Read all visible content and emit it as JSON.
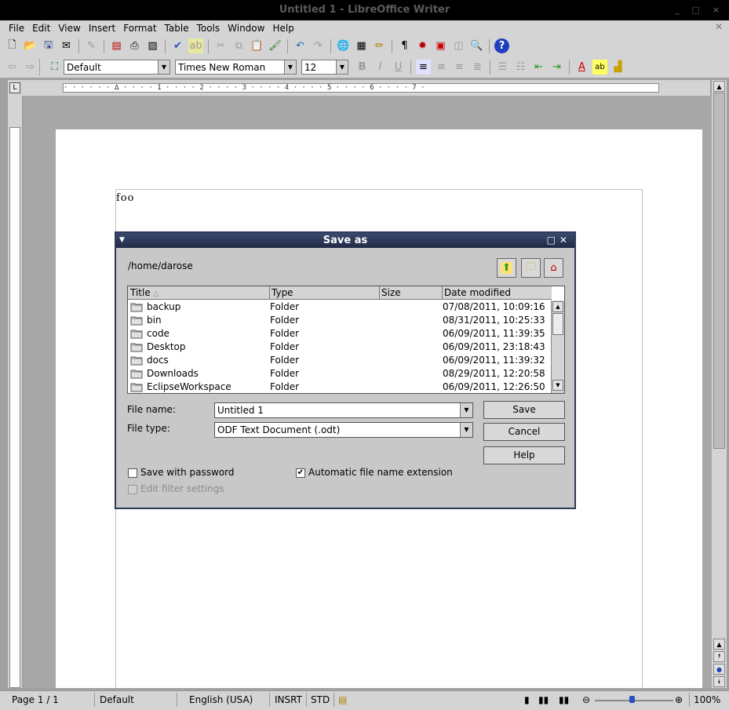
{
  "window": {
    "title": "Untitled 1 - LibreOffice Writer",
    "controls": "_ □ ×"
  },
  "menu": [
    "File",
    "Edit",
    "View",
    "Insert",
    "Format",
    "Table",
    "Tools",
    "Window",
    "Help"
  ],
  "formatting": {
    "style": "Default",
    "font": "Times New Roman",
    "size": "12"
  },
  "document": {
    "text": "foo"
  },
  "dialog": {
    "title": "Save as",
    "path": "/home/darose",
    "columns": [
      "Title",
      "Type",
      "Size",
      "Date modified"
    ],
    "files": [
      {
        "title": "backup",
        "type": "Folder",
        "size": "",
        "date": "07/08/2011, 10:09:16"
      },
      {
        "title": "bin",
        "type": "Folder",
        "size": "",
        "date": "08/31/2011, 10:25:33"
      },
      {
        "title": "code",
        "type": "Folder",
        "size": "",
        "date": "06/09/2011, 11:39:35"
      },
      {
        "title": "Desktop",
        "type": "Folder",
        "size": "",
        "date": "06/09/2011, 23:18:43"
      },
      {
        "title": "docs",
        "type": "Folder",
        "size": "",
        "date": "06/09/2011, 11:39:32"
      },
      {
        "title": "Downloads",
        "type": "Folder",
        "size": "",
        "date": "08/29/2011, 12:20:58"
      },
      {
        "title": "EclipseWorkspace",
        "type": "Folder",
        "size": "",
        "date": "06/09/2011, 12:26:50"
      }
    ],
    "file_name_label": "File name:",
    "file_name_value": "Untitled 1",
    "file_type_label": "File type:",
    "file_type_value": "ODF Text Document (.odt)",
    "save_label": "Save",
    "cancel_label": "Cancel",
    "help_label": "Help",
    "save_with_password": {
      "label": "Save with password",
      "checked": false
    },
    "auto_extension": {
      "label": "Automatic file name extension",
      "checked": true
    },
    "edit_filter": {
      "label": "Edit filter settings",
      "checked": false,
      "disabled": true
    }
  },
  "status": {
    "page": "Page 1 / 1",
    "style": "Default",
    "language": "English (USA)",
    "insert_mode": "INSRT",
    "selection_mode": "STD",
    "zoom": "100%"
  }
}
